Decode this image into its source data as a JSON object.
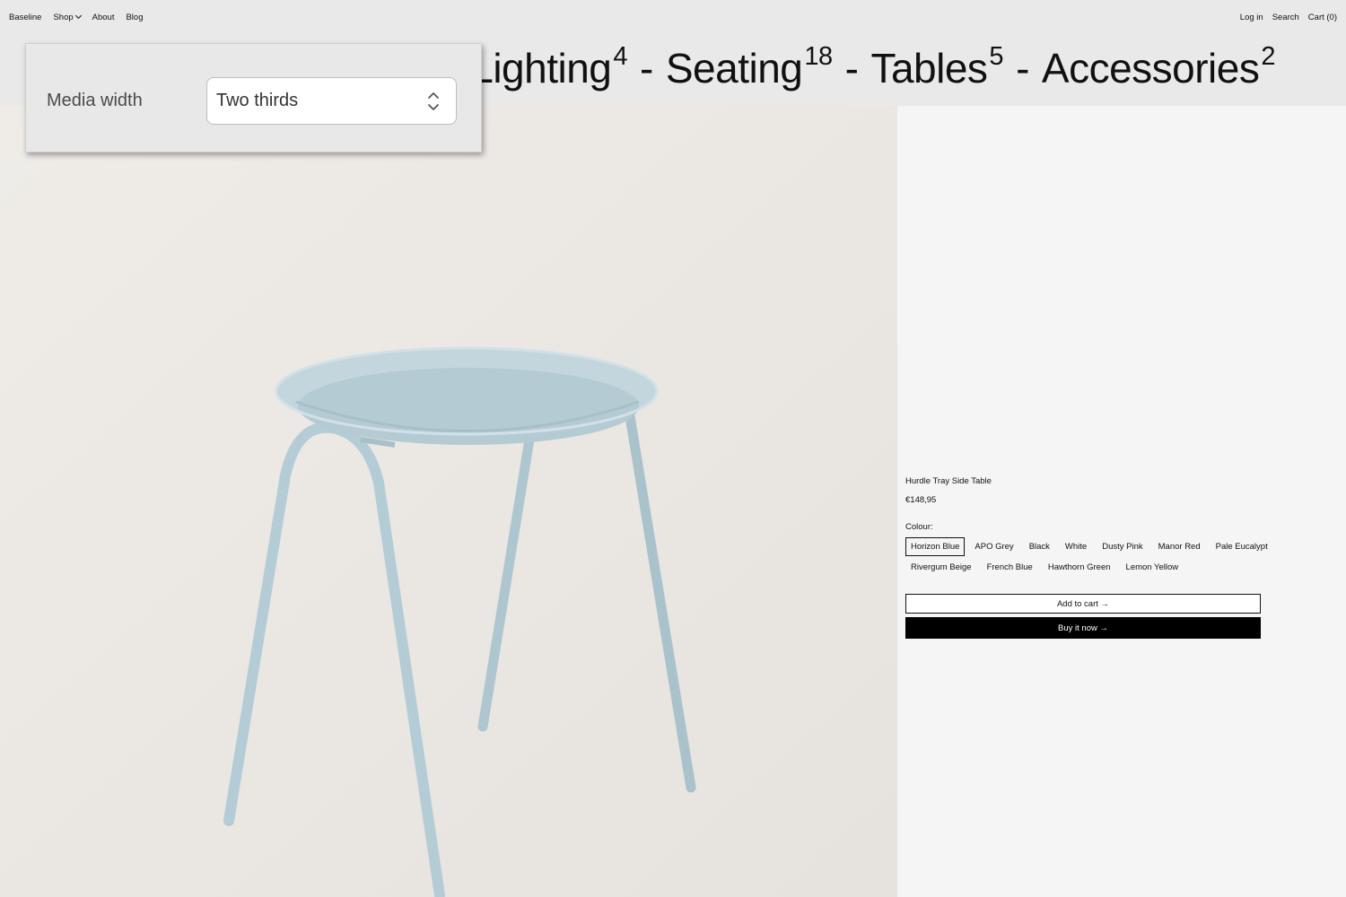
{
  "nav": {
    "left": [
      "Baseline",
      "Shop",
      "About",
      "Blog"
    ],
    "right": [
      "Log in",
      "Search",
      "Cart (0)"
    ]
  },
  "collections": [
    {
      "name": "Lighting",
      "count": "4"
    },
    {
      "name": "Seating",
      "count": "18"
    },
    {
      "name": "Tables",
      "count": "5"
    },
    {
      "name": "Accessories",
      "count": "2"
    }
  ],
  "collection_separator": "-",
  "popover": {
    "label": "Media width",
    "selected": "Two thirds"
  },
  "product": {
    "title": "Hurdle Tray Side Table",
    "price": "€148,95",
    "colour_label": "Colour:",
    "colours": [
      "Horizon Blue",
      "APO Grey",
      "Black",
      "White",
      "Dusty Pink",
      "Manor Red",
      "Pale Eucalypt",
      "Rivergum Beige",
      "French Blue",
      "Hawthorn Green",
      "Lemon Yellow"
    ],
    "selected_colour": "Horizon Blue",
    "add_to_cart": "Add to cart →",
    "buy_now": "Buy it now →"
  },
  "colors": {
    "header_bg": "#e9e9e9",
    "media_bg": "#ece9e5",
    "table_blue": "#b7cdd6",
    "buy_button": "#000000"
  },
  "icons": [
    "chevron-down-icon",
    "select-updown-icon"
  ]
}
